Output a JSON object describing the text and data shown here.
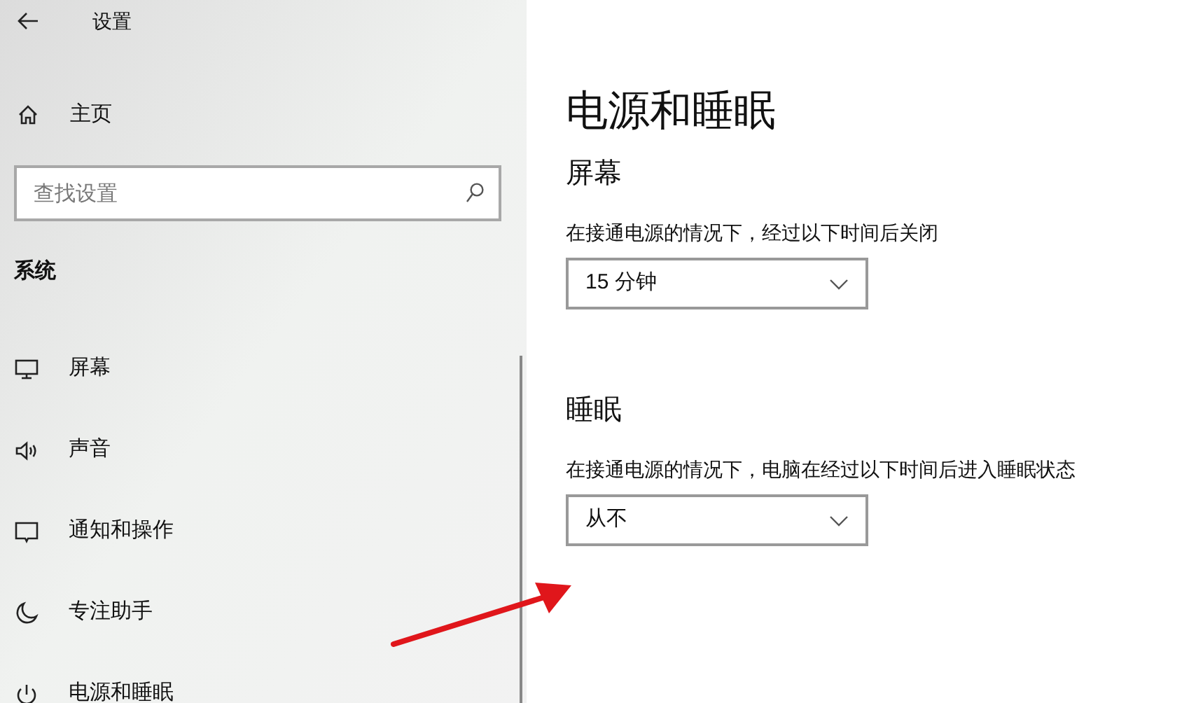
{
  "window": {
    "title": "设置"
  },
  "sidebar": {
    "home": "主页",
    "search": {
      "placeholder": "查找设置"
    },
    "section": "系统",
    "items": [
      {
        "kind": "display",
        "label": "屏幕"
      },
      {
        "kind": "sound",
        "label": "声音"
      },
      {
        "kind": "notifications",
        "label": "通知和操作"
      },
      {
        "kind": "focus",
        "label": "专注助手"
      },
      {
        "kind": "power",
        "label": "电源和睡眠"
      }
    ]
  },
  "page": {
    "title": "电源和睡眠",
    "sections": [
      {
        "heading": "屏幕",
        "description": "在接通电源的情况下，经过以下时间后关闭",
        "value": "15 分钟"
      },
      {
        "heading": "睡眠",
        "description": "在接通电源的情况下，电脑在经过以下时间后进入睡眠状态",
        "value": "从不"
      }
    ]
  }
}
